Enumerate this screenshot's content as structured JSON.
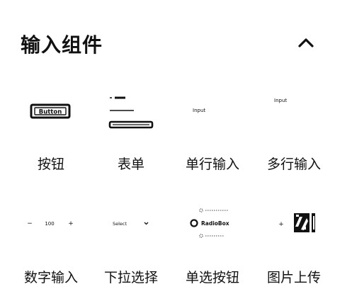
{
  "header": {
    "title": "输入组件",
    "collapse_icon": "chevron-up-icon"
  },
  "components": [
    {
      "label": "按钮",
      "preview_text": "Button"
    },
    {
      "label": "表单",
      "preview_text": ""
    },
    {
      "label": "单行输入",
      "preview_text": "Input"
    },
    {
      "label": "多行输入",
      "preview_text": "Input"
    },
    {
      "label": "数字输入",
      "preview_minus": "−",
      "preview_value": "100",
      "preview_plus": "+"
    },
    {
      "label": "下拉选择",
      "preview_text": "Select"
    },
    {
      "label": "单选按钮",
      "preview_text": "RadioBox"
    },
    {
      "label": "图片上传",
      "preview_plus": "+"
    }
  ]
}
